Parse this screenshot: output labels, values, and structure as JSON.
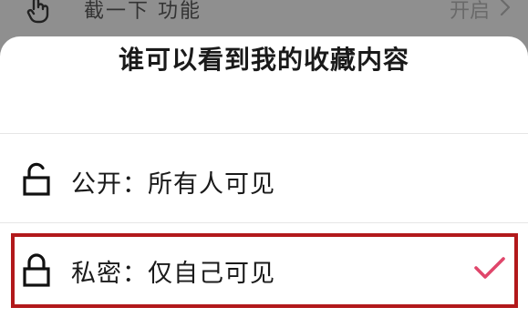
{
  "background_row": {
    "label": "截一下 功能",
    "status": "开启",
    "icon": "hand-pointer-icon"
  },
  "sheet": {
    "title": "谁可以看到我的收藏内容",
    "options": [
      {
        "label": "公开：所有人可见",
        "icon": "unlocked-padlock-icon",
        "selected": false
      },
      {
        "label": "私密：仅自己可见",
        "icon": "locked-padlock-icon",
        "selected": true
      }
    ]
  },
  "colors": {
    "highlight": "#b2191b",
    "check": "#e0466b",
    "overlay": "#8f8f8f"
  }
}
